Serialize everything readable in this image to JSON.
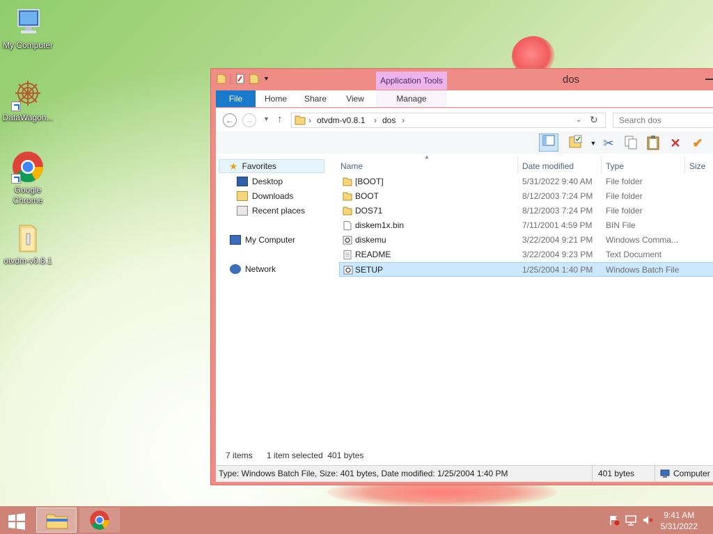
{
  "desktop": {
    "icons": [
      {
        "label": "My Computer"
      },
      {
        "label": "DataWagon..."
      },
      {
        "label": "Google Chrome"
      },
      {
        "label": "otvdm-v0.8.1"
      }
    ]
  },
  "window": {
    "title": "dos",
    "context_tab_group": "Application Tools",
    "tabs": {
      "file": "File",
      "home": "Home",
      "share": "Share",
      "view": "View",
      "manage": "Manage"
    },
    "address": {
      "crumbs": [
        "otvdm-v0.8.1",
        "dos"
      ]
    },
    "search": {
      "placeholder": "Search dos"
    },
    "nav": {
      "favorites": "Favorites",
      "desktop": "Desktop",
      "downloads": "Downloads",
      "recent": "Recent places",
      "my_computer": "My Computer",
      "network": "Network"
    },
    "columns": {
      "name": "Name",
      "date": "Date modified",
      "type": "Type",
      "size": "Size"
    },
    "files": [
      {
        "name": "[BOOT]",
        "date": "5/31/2022 9:40 AM",
        "type": "File folder",
        "icon": "folder-icon"
      },
      {
        "name": "BOOT",
        "date": "8/12/2003 7:24 PM",
        "type": "File folder",
        "icon": "folder-icon"
      },
      {
        "name": "DOS71",
        "date": "8/12/2003 7:24 PM",
        "type": "File folder",
        "icon": "folder-icon"
      },
      {
        "name": "diskem1x.bin",
        "date": "7/11/2001 4:59 PM",
        "type": "BIN File",
        "icon": "file-icon"
      },
      {
        "name": "diskemu",
        "date": "3/22/2004 9:21 PM",
        "type": "Windows Comma...",
        "icon": "gear-file-icon"
      },
      {
        "name": "README",
        "date": "3/22/2004 9:23 PM",
        "type": "Text Document",
        "icon": "text-file-icon"
      },
      {
        "name": "SETUP",
        "date": "1/25/2004 1:40 PM",
        "type": "Windows Batch File",
        "icon": "gear-file-icon"
      }
    ],
    "status": {
      "items": "7 items",
      "selected": "1 item selected  401 bytes"
    },
    "details_bar": {
      "info": "Type: Windows Batch File, Size: 401 bytes, Date modified: 1/25/2004 1:40 PM",
      "size": "401 bytes",
      "location": "Computer"
    }
  },
  "taskbar": {
    "time": "9:41 AM",
    "date": "5/31/2022"
  },
  "colors": {
    "window_frame": "#f08c86",
    "file_tab": "#1979ca",
    "context_tab": "#edb4ea",
    "taskbar": "#cd8376",
    "selection": "#cce8ff"
  }
}
